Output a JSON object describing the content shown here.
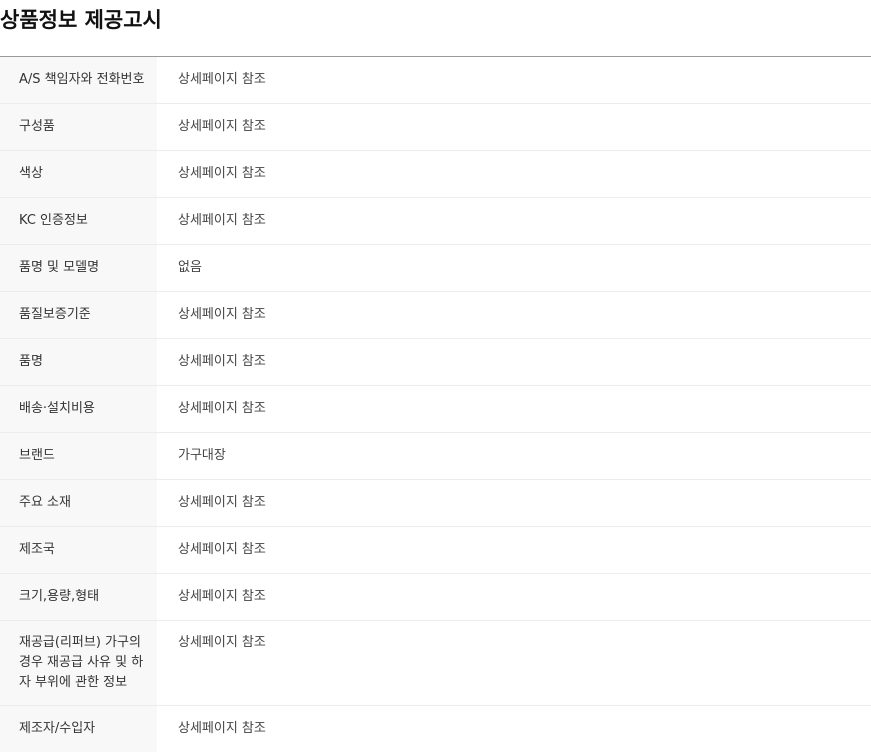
{
  "page_title": "상품정보 제공고시",
  "rows": [
    {
      "label": "A/S 책임자와 전화번호",
      "value": "상세페이지 참조"
    },
    {
      "label": "구성품",
      "value": "상세페이지 참조"
    },
    {
      "label": "색상",
      "value": "상세페이지 참조"
    },
    {
      "label": "KC 인증정보",
      "value": "상세페이지 참조"
    },
    {
      "label": "품명 및 모델명",
      "value": "없음"
    },
    {
      "label": "품질보증기준",
      "value": "상세페이지 참조"
    },
    {
      "label": "품명",
      "value": "상세페이지 참조"
    },
    {
      "label": "배송·설치비용",
      "value": "상세페이지 참조"
    },
    {
      "label": "브랜드",
      "value": "가구대장"
    },
    {
      "label": "주요 소재",
      "value": "상세페이지 참조"
    },
    {
      "label": "제조국",
      "value": "상세페이지 참조"
    },
    {
      "label": "크기,용량,형태",
      "value": "상세페이지 참조"
    },
    {
      "label": "재공급(리퍼브) 가구의 경우 재공급 사유 및 하자 부위에 관한 정보",
      "value": "상세페이지 참조"
    },
    {
      "label": "제조자/수입자",
      "value": "상세페이지 참조"
    }
  ]
}
